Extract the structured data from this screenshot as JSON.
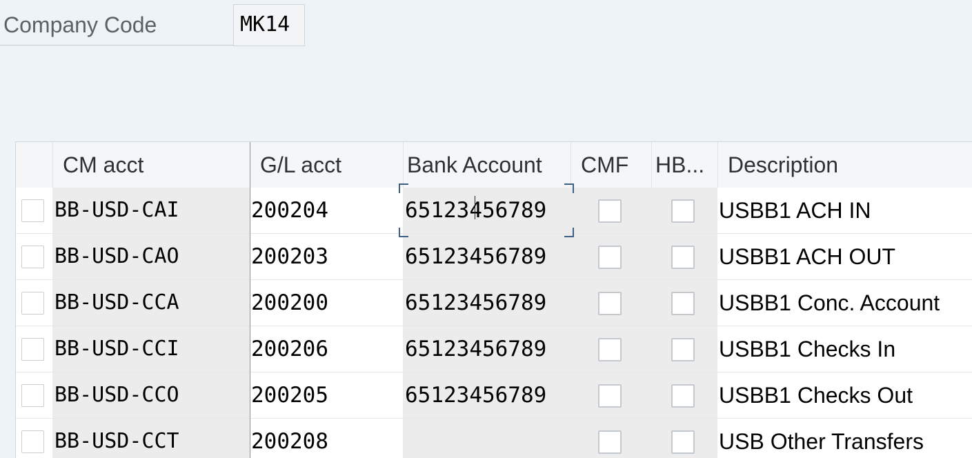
{
  "header": {
    "company_code_label": "Company Code",
    "company_code_value": "MK14"
  },
  "table": {
    "columns": {
      "cm_acct": "CM acct",
      "gl_acct": "G/L acct",
      "bank_account": "Bank Account",
      "cmf": "CMF",
      "hb": "HB...",
      "description": "Description"
    },
    "rows": [
      {
        "cm_acct": "BB-USD-CAI",
        "gl_acct": "200204",
        "bank_account": "65123456789",
        "description": "USBB1 ACH IN"
      },
      {
        "cm_acct": "BB-USD-CAO",
        "gl_acct": "200203",
        "bank_account": "65123456789",
        "description": "USBB1 ACH OUT"
      },
      {
        "cm_acct": "BB-USD-CCA",
        "gl_acct": "200200",
        "bank_account": "65123456789",
        "description": "USBB1 Conc. Account"
      },
      {
        "cm_acct": "BB-USD-CCI",
        "gl_acct": "200206",
        "bank_account": "65123456789",
        "description": "USBB1 Checks In"
      },
      {
        "cm_acct": "BB-USD-CCO",
        "gl_acct": "200205",
        "bank_account": "65123456789",
        "description": "USBB1 Checks Out"
      },
      {
        "cm_acct": "BB-USD-CCT",
        "gl_acct": "200208",
        "bank_account": "",
        "description": "USB Other Transfers"
      }
    ]
  }
}
